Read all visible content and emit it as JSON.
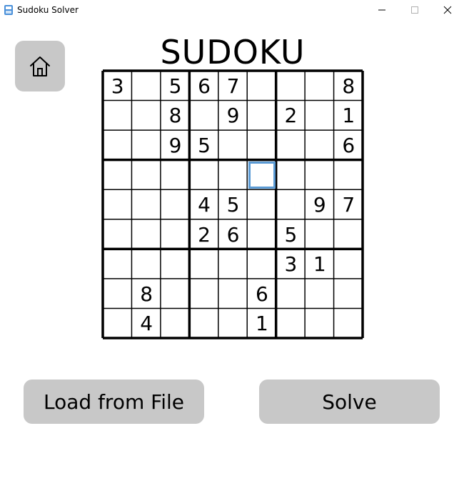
{
  "window": {
    "title": "Sudoku Solver",
    "controls": {
      "minimize": "minimize-icon",
      "maximize": "maximize-icon",
      "close": "close-icon"
    }
  },
  "header": {
    "title": "SUDOKU",
    "home_icon": "home-icon"
  },
  "board": {
    "selected_cell": {
      "row": 3,
      "col": 5
    },
    "selection_color": "#5b9bd5",
    "cells": [
      [
        "3",
        "",
        "5",
        "6",
        "7",
        "",
        "",
        "",
        "8"
      ],
      [
        "",
        "",
        "8",
        "",
        "9",
        "",
        "2",
        "",
        "1"
      ],
      [
        "",
        "",
        "9",
        "5",
        "",
        "",
        "",
        "",
        "6"
      ],
      [
        "",
        "",
        "",
        "",
        "",
        "",
        "",
        "",
        ""
      ],
      [
        "",
        "",
        "",
        "4",
        "5",
        "",
        "",
        "9",
        "7"
      ],
      [
        "",
        "",
        "",
        "2",
        "6",
        "",
        "5",
        "",
        ""
      ],
      [
        "",
        "",
        "",
        "",
        "",
        "",
        "3",
        "1",
        ""
      ],
      [
        "",
        "8",
        "",
        "",
        "",
        "6",
        "",
        "",
        ""
      ],
      [
        "",
        "4",
        "",
        "",
        "",
        "1",
        "",
        "",
        ""
      ]
    ]
  },
  "actions": {
    "load_label": "Load from File",
    "solve_label": "Solve"
  },
  "colors": {
    "button_bg": "#c8c8c8",
    "grid_line": "#000000"
  }
}
